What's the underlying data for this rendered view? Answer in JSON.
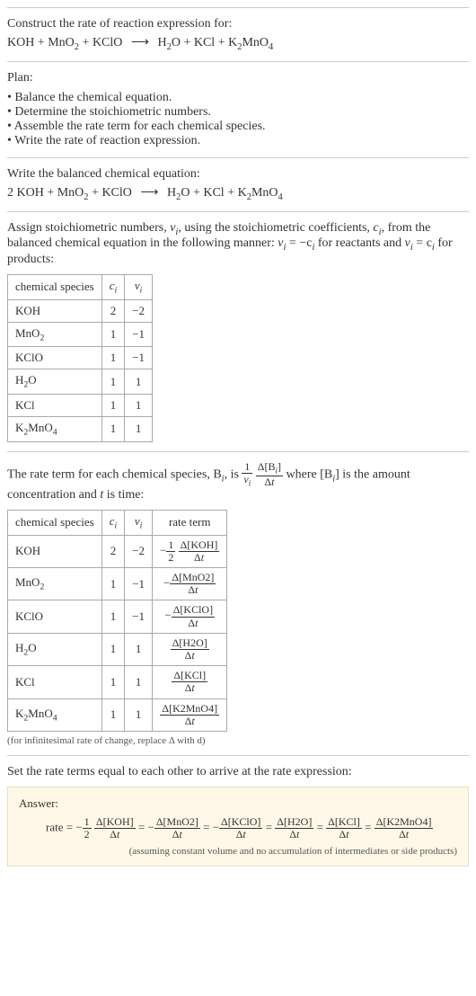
{
  "s1": {
    "intro": "Construct the rate of reaction expression for:",
    "eq_lhs1": "KOH + MnO",
    "eq_lhs2": " + KClO ",
    "eq_rhs1": " H",
    "eq_rhs2": "O + KCl + K",
    "eq_rhs3": "MnO"
  },
  "s2": {
    "hdr": "Plan:",
    "b1": "Balance the chemical equation.",
    "b2": "Determine the stoichiometric numbers.",
    "b3": "Assemble the rate term for each chemical species.",
    "b4": "Write the rate of reaction expression."
  },
  "s3": {
    "hdr": "Write the balanced chemical equation:",
    "lhs": "2 KOH + MnO",
    "mid": " + KClO ",
    "r1": " H",
    "r2": "O + KCl + K",
    "r3": "MnO"
  },
  "s4": {
    "p1a": "Assign stoichiometric numbers, ",
    "p1b": ", using the stoichiometric coefficients, ",
    "p1c": ", from the balanced chemical equation in the following manner: ",
    "p1d": " for reactants and ",
    "p1e": " for products:",
    "nu_i": "ν",
    "c_i": "c",
    "sub_i": "i",
    "rel_react": " = −c",
    "rel_prod": " = c",
    "th_sp": "chemical species",
    "th_c": "c",
    "th_nu": "ν",
    "rows": [
      {
        "sp": "KOH",
        "c": "2",
        "nu": "−2"
      },
      {
        "sp": "MnO2",
        "c": "1",
        "nu": "−1"
      },
      {
        "sp": "KClO",
        "c": "1",
        "nu": "−1"
      },
      {
        "sp": "H2O",
        "c": "1",
        "nu": "1"
      },
      {
        "sp": "KCl",
        "c": "1",
        "nu": "1"
      },
      {
        "sp": "K2MnO4",
        "c": "1",
        "nu": "1"
      }
    ]
  },
  "s5": {
    "p_a": "The rate term for each chemical species, B",
    "p_b": ", is ",
    "p_c": " where [B",
    "p_d": "] is the amount concentration and ",
    "p_e": " is time:",
    "t_var": "t",
    "one": "1",
    "nu_i": "ν",
    "sub_i": "i",
    "dB": "Δ[B",
    "dB2": "]",
    "dt": "Δt",
    "th_sp": "chemical species",
    "th_c": "c",
    "th_nu": "ν",
    "th_rt": "rate term",
    "rows": [
      {
        "sp": "KOH",
        "c": "2",
        "nu": "−2",
        "neg": "−",
        "fn": "1",
        "fd": "2",
        "conc": "Δ[KOH]"
      },
      {
        "sp": "MnO2",
        "c": "1",
        "nu": "−1",
        "neg": "−",
        "fn": "",
        "fd": "",
        "conc": "Δ[MnO2]"
      },
      {
        "sp": "KClO",
        "c": "1",
        "nu": "−1",
        "neg": "−",
        "fn": "",
        "fd": "",
        "conc": "Δ[KClO]"
      },
      {
        "sp": "H2O",
        "c": "1",
        "nu": "1",
        "neg": "",
        "fn": "",
        "fd": "",
        "conc": "Δ[H2O]"
      },
      {
        "sp": "KCl",
        "c": "1",
        "nu": "1",
        "neg": "",
        "fn": "",
        "fd": "",
        "conc": "Δ[KCl]"
      },
      {
        "sp": "K2MnO4",
        "c": "1",
        "nu": "1",
        "neg": "",
        "fn": "",
        "fd": "",
        "conc": "Δ[K2MnO4]"
      }
    ],
    "note": "(for infinitesimal rate of change, replace Δ with d)"
  },
  "s6": {
    "hdr": "Set the rate terms equal to each other to arrive at the rate expression:"
  },
  "ans": {
    "hdr": "Answer:",
    "rate": "rate = ",
    "neg": "−",
    "half_n": "1",
    "half_d": "2",
    "t1": "Δ[KOH]",
    "t2": "Δ[MnO2]",
    "t3": "Δ[KClO]",
    "t4": "Δ[H2O]",
    "t5": "Δ[KCl]",
    "t6": "Δ[K2MnO4]",
    "dt": "Δt",
    "eq": " = ",
    "assume": "(assuming constant volume and no accumulation of intermediates or side products)"
  }
}
